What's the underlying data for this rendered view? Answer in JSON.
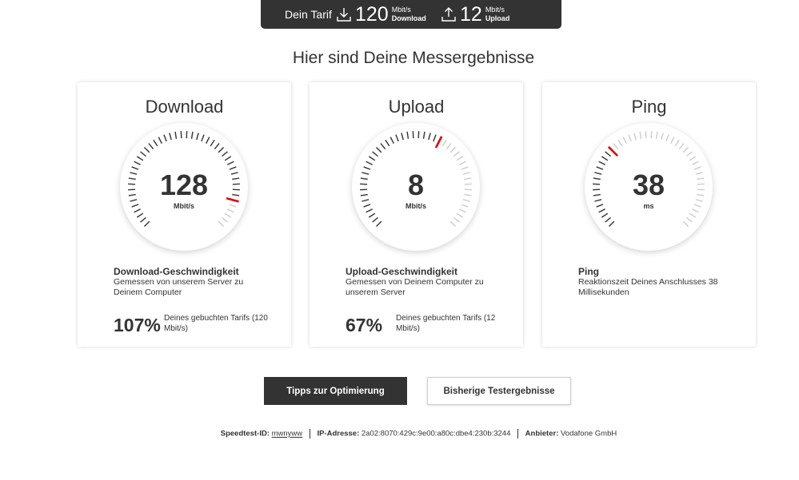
{
  "tariff": {
    "label": "Dein Tarif",
    "download_value": "120",
    "download_unit": "Mbit/s",
    "download_label": "Download",
    "upload_value": "12",
    "upload_unit": "Mbit/s",
    "upload_label": "Upload"
  },
  "page_title": "Hier sind Deine Messergebnisse",
  "cards": [
    {
      "title": "Download",
      "value": "128",
      "unit": "Mbit/s",
      "gauge_fraction": 0.89,
      "heading": "Download-Geschwindigkeit",
      "description": "Gemessen von unserem Server zu Deinem Computer",
      "percent": "107%",
      "percent_note": "Deines gebuchten Tarifs (120 Mbit/s)"
    },
    {
      "title": "Upload",
      "value": "8",
      "unit": "Mbit/s",
      "gauge_fraction": 0.6,
      "heading": "Upload-Geschwindigkeit",
      "description": "Gemessen von Deinem Computer zu unserem Server",
      "percent": "67%",
      "percent_note": "Deines gebuchten Tarifs (12 Mbit/s)"
    },
    {
      "title": "Ping",
      "value": "38",
      "unit": "ms",
      "gauge_fraction": 0.34,
      "heading": "Ping",
      "description": "Reaktionszeit Deines Anschlusses 38 Millisekunden"
    }
  ],
  "buttons": {
    "tips": "Tipps zur Optimierung",
    "history": "Bisherige Testergebnisse"
  },
  "footer": {
    "speedtest_id_label": "Speedtest-ID:",
    "speedtest_id_value": "mwnyww",
    "ip_label": "IP-Adresse:",
    "ip_value": "2a02:8070:429c:9e00:a80c:dbe4:230b:3244",
    "provider_label": "Anbieter:",
    "provider_value": "Vodafone GmbH"
  },
  "colors": {
    "dark": "#333333",
    "accent_red": "#e60000",
    "tick_active": "#333333",
    "tick_inactive": "#cccccc"
  },
  "icons": {
    "download": "download-icon",
    "upload": "upload-icon"
  }
}
